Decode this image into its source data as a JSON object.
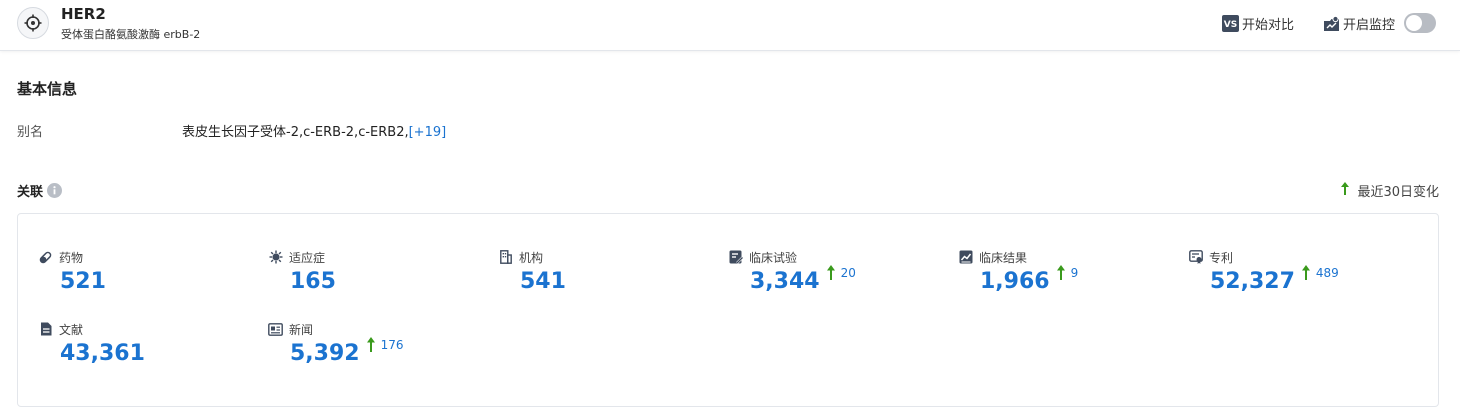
{
  "header": {
    "title": "HER2",
    "subtitle": "受体蛋白酪氨酸激酶 erbB-2",
    "compare_label": "开始对比",
    "monitor_label": "开启监控",
    "monitor_enabled": false
  },
  "basic_info": {
    "title": "基本信息",
    "alias_label": "别名",
    "alias_value": "表皮生长因子受体-2,c-ERB-2,c-ERB2,",
    "alias_more": "[+19]"
  },
  "relations": {
    "title": "关联",
    "recent_label": "最近30日变化",
    "colors": {
      "value": "#1b73d0",
      "up_arrow": "#3a9a1c"
    },
    "items": [
      {
        "label": "药物",
        "icon": "pill-icon",
        "value": "521",
        "delta": null
      },
      {
        "label": "适应症",
        "icon": "virus-icon",
        "value": "165",
        "delta": null
      },
      {
        "label": "机构",
        "icon": "building-icon",
        "value": "541",
        "delta": null
      },
      {
        "label": "临床试验",
        "icon": "clinical-trial-icon",
        "value": "3,344",
        "delta": "20"
      },
      {
        "label": "临床结果",
        "icon": "clinical-result-icon",
        "value": "1,966",
        "delta": "9"
      },
      {
        "label": "专利",
        "icon": "patent-icon",
        "value": "52,327",
        "delta": "489"
      },
      {
        "label": "文献",
        "icon": "document-icon",
        "value": "43,361",
        "delta": null
      },
      {
        "label": "新闻",
        "icon": "news-icon",
        "value": "5,392",
        "delta": "176"
      }
    ]
  }
}
